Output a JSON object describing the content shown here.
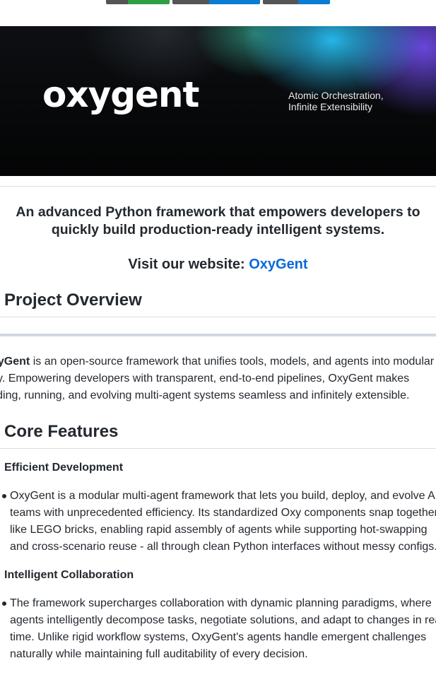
{
  "badges": [
    {
      "left_color": "#555555",
      "right_color": "#2ea043"
    },
    {
      "left_color": "#555555",
      "right_color": "#0a7cd4"
    },
    {
      "left_color": "#555555",
      "right_color": "#0a7cd4"
    }
  ],
  "banner": {
    "logo_text": "oxygent",
    "tagline_line1": "Atomic Orchestration,",
    "tagline_line2": "Infinite Extensibility"
  },
  "lead": {
    "line1": "An advanced Python framework that empowers developers to",
    "line2": "quickly build production-ready intelligent systems."
  },
  "visit": {
    "label": "Visit our website: ",
    "link_text": "OxyGent"
  },
  "project_overview": {
    "heading": "Project Overview",
    "bold_start": "xyGent",
    "line1_rest": " is an open-source framework that unifies tools, models, and agents into modular",
    "line2": "xy. Empowering developers with transparent, end-to-end pipelines, OxyGent makes",
    "line3": "ilding, running, and evolving multi-agent systems seamless and infinitely extensible."
  },
  "core_features": {
    "heading": "Core Features",
    "features": [
      {
        "title": "Efficient Development",
        "lines": [
          "OxyGent is a modular multi-agent framework that lets you build, deploy, and evolve AI",
          "teams with unprecedented efficiency. Its standardized Oxy components snap together",
          "like LEGO bricks, enabling rapid assembly of agents while supporting hot-swapping",
          "and cross-scenario reuse - all through clean Python interfaces without messy configs."
        ]
      },
      {
        "title": "Intelligent Collaboration",
        "lines": [
          "The framework supercharges collaboration with dynamic planning paradigms, where",
          "agents intelligently decompose tasks, negotiate solutions, and adapt to changes in real-",
          "time. Unlike rigid workflow systems, OxyGent's agents handle emergent challenges",
          "naturally while maintaining full auditability of every decision."
        ]
      }
    ]
  }
}
